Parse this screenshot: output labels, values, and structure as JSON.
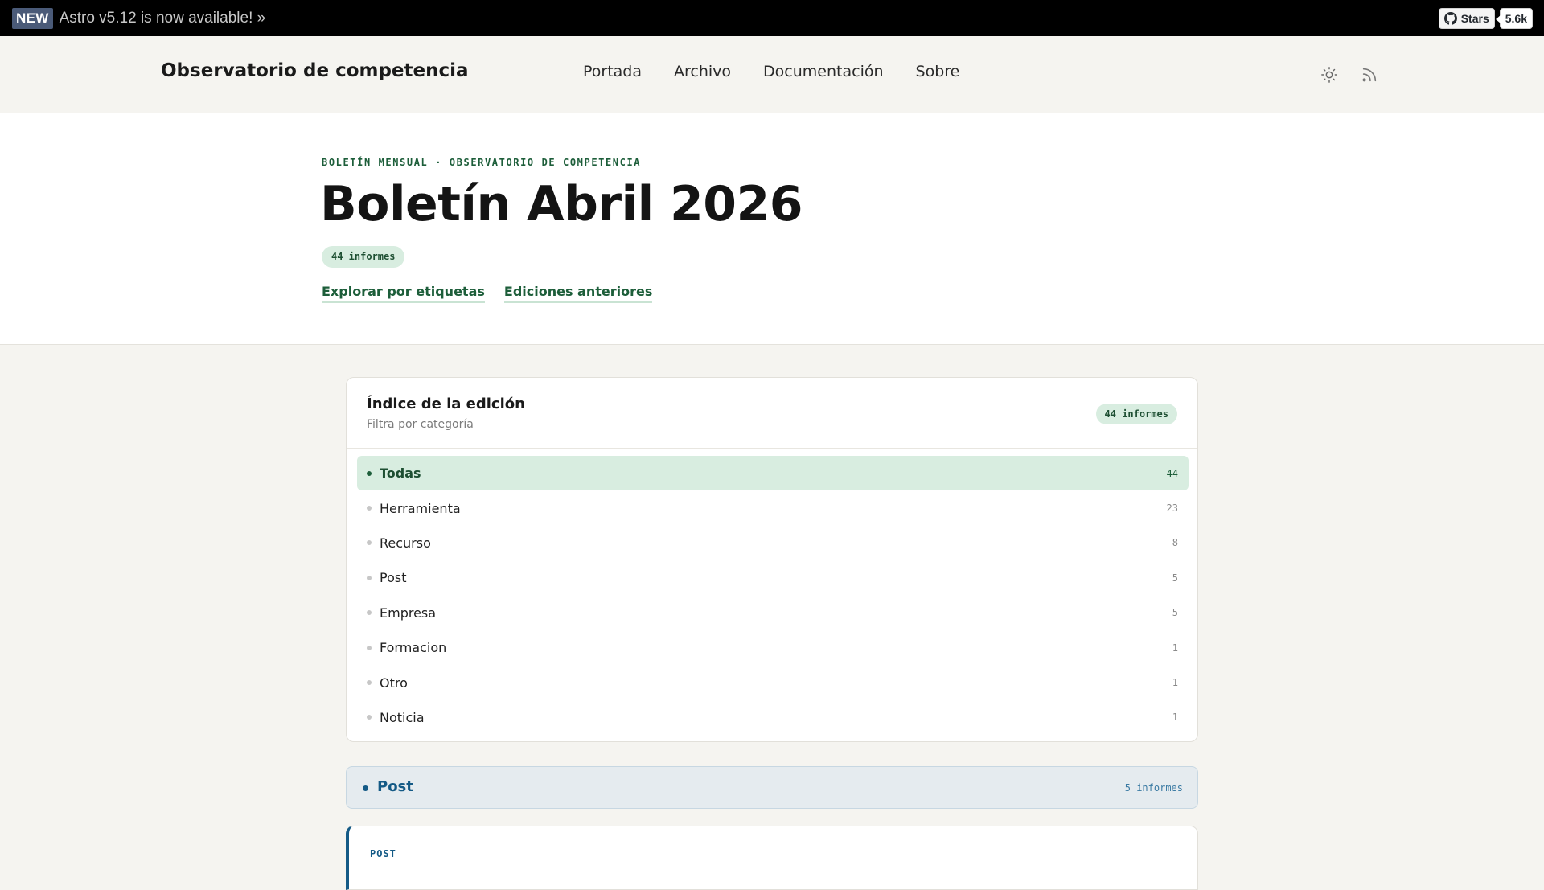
{
  "topbar": {
    "badge": "NEW",
    "announcement": "Astro v5.12 is now available! »",
    "github": {
      "label": "Stars",
      "count": "5.6k"
    }
  },
  "header": {
    "site_title": "Observatorio de competencia",
    "nav": [
      "Portada",
      "Archivo",
      "Documentación",
      "Sobre"
    ],
    "icons": [
      "sun-icon",
      "rss-icon"
    ]
  },
  "hero": {
    "kicker": "BOLETÍN MENSUAL · OBSERVATORIO DE COMPETENCIA",
    "title": "Boletín Abril 2026",
    "count_pill": "44 informes",
    "links": [
      "Explorar por etiquetas",
      "Ediciones anteriores"
    ]
  },
  "index": {
    "title": "Índice de la edición",
    "subtitle": "Filtra por categoría",
    "count_pill": "44 informes",
    "categories": [
      {
        "label": "Todas",
        "count": "44",
        "active": true
      },
      {
        "label": "Herramienta",
        "count": "23"
      },
      {
        "label": "Recurso",
        "count": "8"
      },
      {
        "label": "Post",
        "count": "5"
      },
      {
        "label": "Empresa",
        "count": "5"
      },
      {
        "label": "Formacion",
        "count": "1"
      },
      {
        "label": "Otro",
        "count": "1"
      },
      {
        "label": "Noticia",
        "count": "1"
      }
    ]
  },
  "section": {
    "label": "Post",
    "count": "5 informes"
  },
  "post": {
    "tag": "POST"
  },
  "colors": {
    "accent_green": "#1d5e3a",
    "accent_blue": "#145a86",
    "pill_bg": "#d8ede0"
  }
}
